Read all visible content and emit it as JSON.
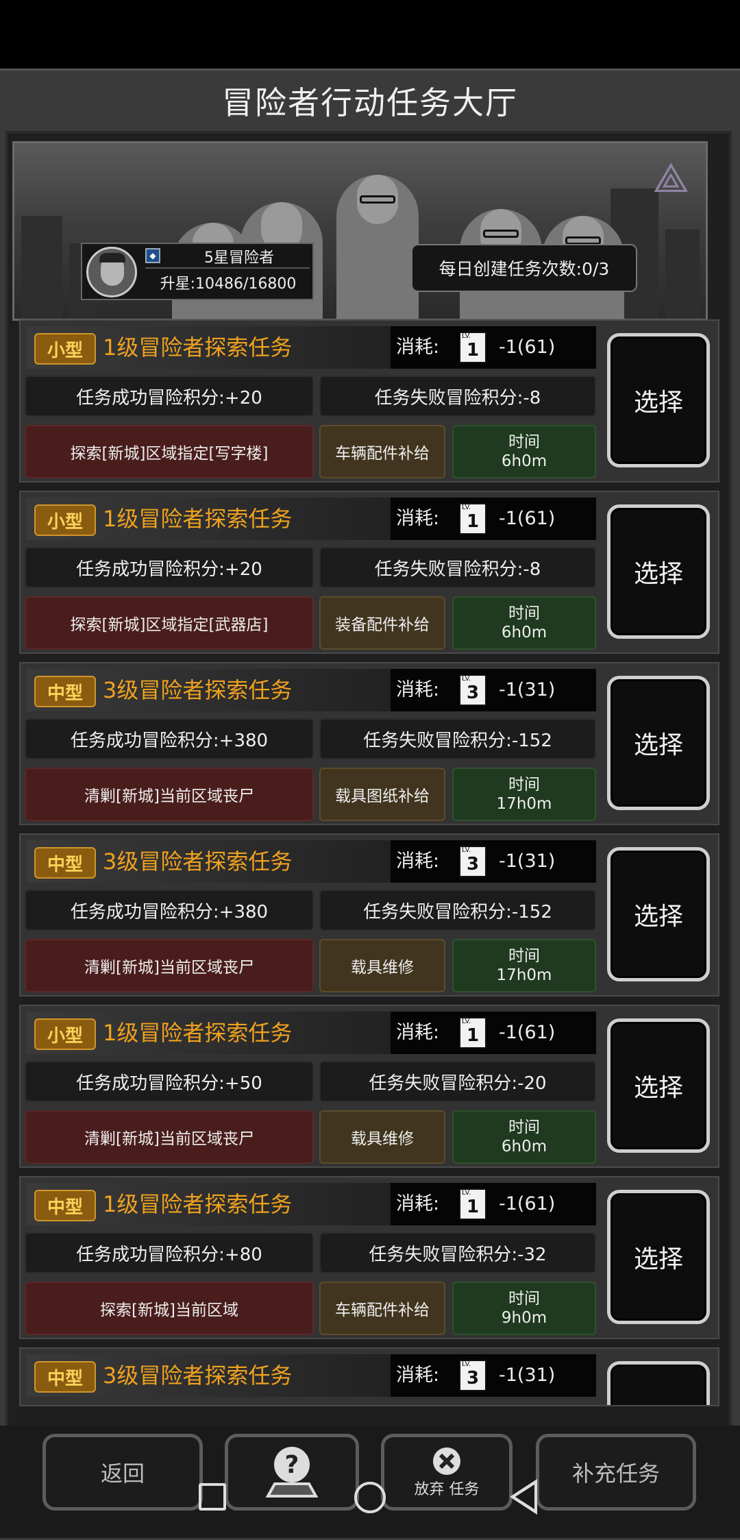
{
  "header": {
    "title": "冒险者行动任务大厅"
  },
  "banner": {
    "rank": "5星冒险者",
    "upgrade": "升星:10486/16800",
    "daily_tasks": "每日创建任务次数:0/3"
  },
  "cost_label": "消耗:",
  "select_label": "选择",
  "tasks": [
    {
      "size": "小型",
      "name": "1级冒险者探索任务",
      "card": "1",
      "cost": "-1(61)",
      "success": "任务成功冒险积分:+20",
      "fail": "任务失败冒险积分:-8",
      "target": "探索[新城]区域指定[写字楼]",
      "reward": "车辆配件补给",
      "time_label": "时间",
      "time": "6h0m"
    },
    {
      "size": "小型",
      "name": "1级冒险者探索任务",
      "card": "1",
      "cost": "-1(61)",
      "success": "任务成功冒险积分:+20",
      "fail": "任务失败冒险积分:-8",
      "target": "探索[新城]区域指定[武器店]",
      "reward": "装备配件补给",
      "time_label": "时间",
      "time": "6h0m"
    },
    {
      "size": "中型",
      "name": "3级冒险者探索任务",
      "card": "3",
      "cost": "-1(31)",
      "success": "任务成功冒险积分:+380",
      "fail": "任务失败冒险积分:-152",
      "target": "清剿[新城]当前区域丧尸",
      "reward": "载具图纸补给",
      "time_label": "时间",
      "time": "17h0m"
    },
    {
      "size": "中型",
      "name": "3级冒险者探索任务",
      "card": "3",
      "cost": "-1(31)",
      "success": "任务成功冒险积分:+380",
      "fail": "任务失败冒险积分:-152",
      "target": "清剿[新城]当前区域丧尸",
      "reward": "载具维修",
      "time_label": "时间",
      "time": "17h0m"
    },
    {
      "size": "小型",
      "name": "1级冒险者探索任务",
      "card": "1",
      "cost": "-1(61)",
      "success": "任务成功冒险积分:+50",
      "fail": "任务失败冒险积分:-20",
      "target": "清剿[新城]当前区域丧尸",
      "reward": "载具维修",
      "time_label": "时间",
      "time": "6h0m"
    },
    {
      "size": "中型",
      "name": "1级冒险者探索任务",
      "card": "1",
      "cost": "-1(61)",
      "success": "任务成功冒险积分:+80",
      "fail": "任务失败冒险积分:-32",
      "target": "探索[新城]当前区域",
      "reward": "车辆配件补给",
      "time_label": "时间",
      "time": "9h0m"
    },
    {
      "size": "中型",
      "name": "3级冒险者探索任务",
      "card": "3",
      "cost": "-1(31)"
    }
  ],
  "bottom": {
    "back": "返回",
    "abandon": "放弃 任务",
    "supplement": "补充任务"
  },
  "icons": [
    "avatar",
    "star-rank-icon",
    "lv-card-icon",
    "help-icon",
    "close-icon",
    "nav-square-icon",
    "nav-circle-icon",
    "nav-back-icon"
  ],
  "colors": {
    "task_name": "#f0a21e",
    "badge": "#8a5c10",
    "target_chip": "#4a1d1d",
    "reward_chip": "#41351f",
    "time_chip": "#1f3a1f"
  }
}
